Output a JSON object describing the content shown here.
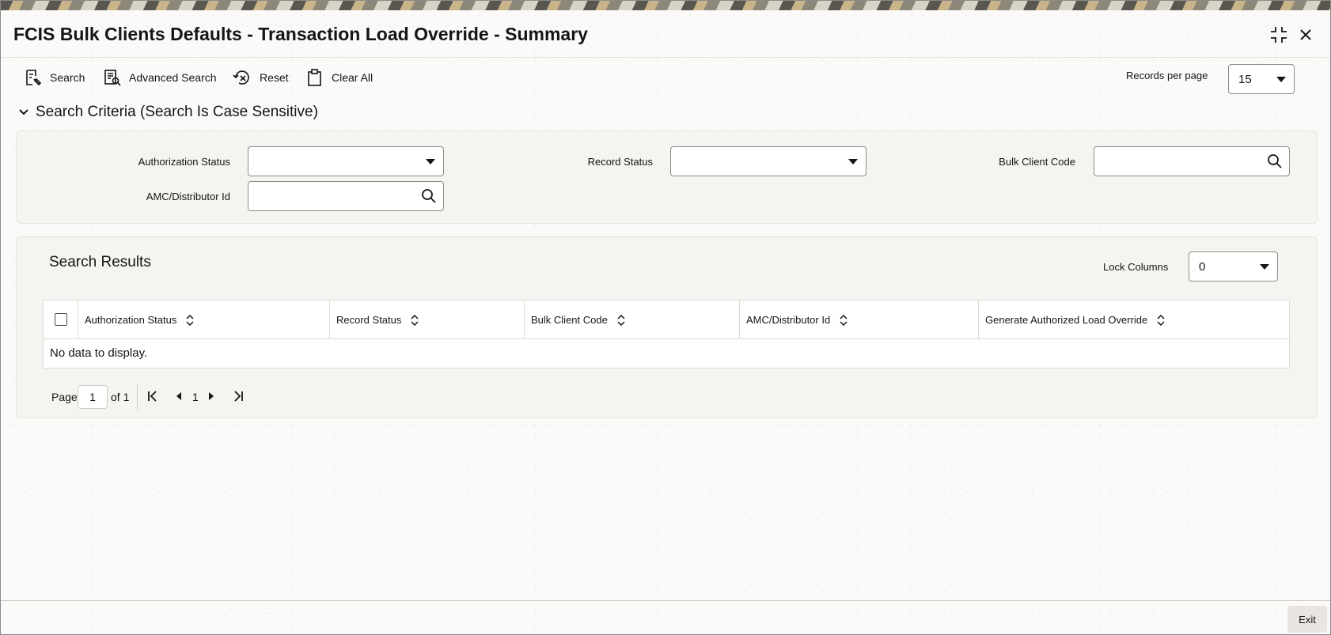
{
  "window": {
    "title": "FCIS Bulk Clients Defaults - Transaction Load Override - Summary",
    "maximize_icon": "collapse-arrows-icon",
    "close_icon": "close-icon"
  },
  "toolbar": {
    "search_label": "Search",
    "advanced_search_label": "Advanced Search",
    "reset_label": "Reset",
    "clear_all_label": "Clear All",
    "records_per_page_label": "Records per page",
    "records_per_page_value": "15"
  },
  "search_criteria": {
    "header": "Search Criteria (Search Is Case Sensitive)",
    "fields": {
      "authorization_status": {
        "label": "Authorization Status",
        "value": ""
      },
      "record_status": {
        "label": "Record Status",
        "value": ""
      },
      "bulk_client_code": {
        "label": "Bulk Client Code",
        "value": ""
      },
      "amc_distributor_id": {
        "label": "AMC/Distributor Id",
        "value": ""
      }
    }
  },
  "results": {
    "title": "Search Results",
    "lock_columns_label": "Lock Columns",
    "lock_columns_value": "0",
    "columns": [
      "Authorization Status",
      "Record Status",
      "Bulk Client Code",
      "AMC/Distributor Id",
      "Generate Authorized Load Override"
    ],
    "empty_message": "No data to display."
  },
  "pagination": {
    "page_label": "Page",
    "current_page": "1",
    "of_label": "of 1",
    "page_number": "1"
  },
  "footer": {
    "exit_label": "Exit"
  },
  "colors": {
    "text": "#161513",
    "border": "#8f8b86",
    "panel": "#f5f3f0"
  }
}
